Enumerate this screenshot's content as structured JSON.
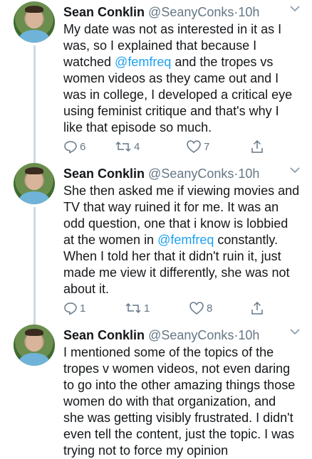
{
  "tweets": [
    {
      "name": "Sean Conklin",
      "handle": "@SeanyConks",
      "separator": "·",
      "time": "10h",
      "lines": [
        {
          "pre": "My date was not as interested in it as I",
          "mention": "",
          "post": ""
        },
        {
          "pre": "was, so I explained that because I",
          "mention": "",
          "post": ""
        },
        {
          "pre": "watched ",
          "mention": "@femfreq",
          "post": " and the tropes vs"
        },
        {
          "pre": "women videos as they came out and I",
          "mention": "",
          "post": ""
        },
        {
          "pre": "was in college, I developed a critical eye",
          "mention": "",
          "post": ""
        },
        {
          "pre": "using feminist critique and that's why I",
          "mention": "",
          "post": ""
        },
        {
          "pre": "like that episode so much.",
          "mention": "",
          "post": ""
        }
      ],
      "replies": "6",
      "retweets": "4",
      "likes": "7"
    },
    {
      "name": "Sean Conklin",
      "handle": "@SeanyConks",
      "separator": "·",
      "time": "10h",
      "lines": [
        {
          "pre": "She then asked me if viewing movies and",
          "mention": "",
          "post": ""
        },
        {
          "pre": "TV that way ruined it for me. It was an",
          "mention": "",
          "post": ""
        },
        {
          "pre": "odd question, one that i know is lobbied",
          "mention": "",
          "post": ""
        },
        {
          "pre": "at the women in ",
          "mention": "@femfreq",
          "post": " constantly."
        },
        {
          "pre": "When I told her that it didn't ruin it, just",
          "mention": "",
          "post": ""
        },
        {
          "pre": "made me view it differently, she was not",
          "mention": "",
          "post": ""
        },
        {
          "pre": "about it.",
          "mention": "",
          "post": ""
        }
      ],
      "replies": "1",
      "retweets": "1",
      "likes": "8"
    },
    {
      "name": "Sean Conklin",
      "handle": "@SeanyConks",
      "separator": "·",
      "time": "10h",
      "lines": [
        {
          "pre": "I mentioned some of the topics of the",
          "mention": "",
          "post": ""
        },
        {
          "pre": "tropes v women videos, not even daring",
          "mention": "",
          "post": ""
        },
        {
          "pre": "to go into the other amazing things those",
          "mention": "",
          "post": ""
        },
        {
          "pre": "women do with that organization, and",
          "mention": "",
          "post": ""
        },
        {
          "pre": "she was getting visibly frustrated. I didn't",
          "mention": "",
          "post": ""
        },
        {
          "pre": "even tell the content, just the topic. I was",
          "mention": "",
          "post": ""
        },
        {
          "pre": "trying not to force my opinion",
          "mention": "",
          "post": ""
        }
      ]
    }
  ],
  "colors": {
    "link": "#1da1f2",
    "muted": "#657786",
    "text": "#14171a",
    "thread_line": "#cfd9de"
  }
}
